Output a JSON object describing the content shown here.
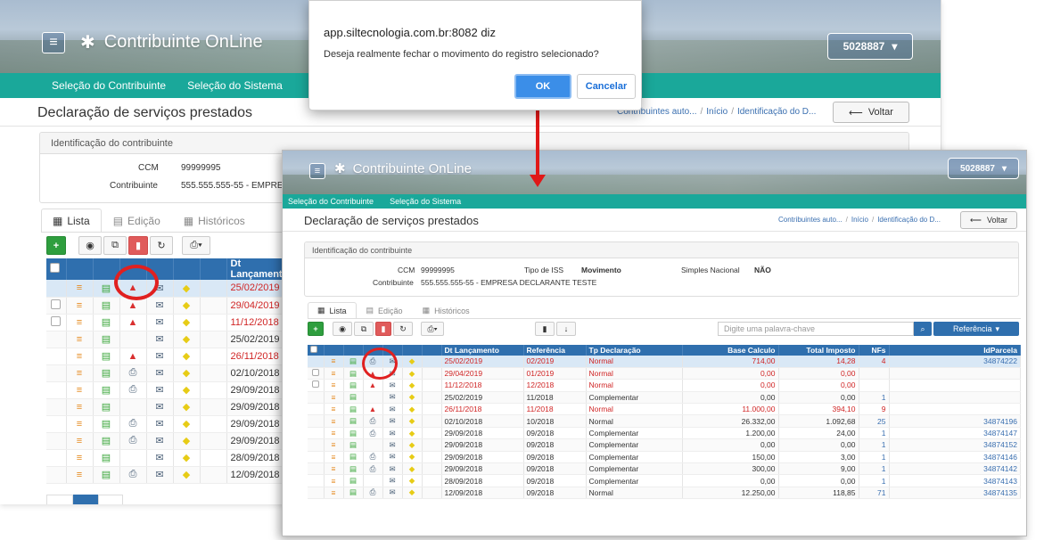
{
  "app": {
    "brand": "Contribuinte OnLine",
    "user": "5028887"
  },
  "nav": {
    "item1": "Seleção do Contribuinte",
    "item2": "Seleção do Sistema"
  },
  "page": {
    "title": "Declaração de serviços prestados",
    "breadcrumb": [
      "Contribuintes auto...",
      "Início",
      "Identificação do D..."
    ],
    "back_label": "Voltar"
  },
  "contrib": {
    "header": "Identificação do contribuinte",
    "ccm_label": "CCM",
    "ccm_value": "99999995",
    "contrib_label": "Contribuinte",
    "contrib_value": "555.555.555-55 - EMPRESA DECLARANTE TESTE",
    "contrib_value_short": "555.555.555-55 - EMPRE",
    "iss_label": "Tipo de ISS",
    "iss_value": "Movimento",
    "simples_label": "Simples Nacional",
    "simples_value": "NÃO"
  },
  "tabs": [
    "Lista",
    "Edição",
    "Históricos"
  ],
  "search": {
    "placeholder": "Digite uma palavra-chave",
    "ref_label": "Referência"
  },
  "columns": [
    "Dt Lançamento",
    "Referência",
    "Tp Declaração",
    "Base Calculo",
    "Total Imposto",
    "NFs",
    "IdParcela"
  ],
  "rows": [
    {
      "dt": "25/02/2019",
      "ref": "02/2019",
      "tp": "Normal",
      "base": "714,00",
      "imp": "14,28",
      "nfs": "4",
      "id": "34874222",
      "red": true,
      "chk": false,
      "sel": true,
      "lock": "print",
      "back_lock": "lock"
    },
    {
      "dt": "29/04/2019",
      "ref": "01/2019",
      "tp": "Normal",
      "base": "0,00",
      "imp": "0,00",
      "nfs": "",
      "id": "",
      "red": true,
      "chk": true,
      "lock": "lock"
    },
    {
      "dt": "11/12/2018",
      "ref": "12/2018",
      "tp": "Normal",
      "base": "0,00",
      "imp": "0,00",
      "nfs": "",
      "id": "",
      "red": true,
      "chk": true,
      "lock": "lock"
    },
    {
      "dt": "25/02/2019",
      "ref": "11/2018",
      "tp": "Complementar",
      "base": "0,00",
      "imp": "0,00",
      "nfs": "1",
      "id": "",
      "red": false,
      "chk": false,
      "lock": ""
    },
    {
      "dt": "26/11/2018",
      "ref": "11/2018",
      "tp": "Normal",
      "base": "11.000,00",
      "imp": "394,10",
      "nfs": "9",
      "id": "",
      "red": true,
      "chk": false,
      "lock": "lock"
    },
    {
      "dt": "02/10/2018",
      "ref": "10/2018",
      "tp": "Normal",
      "base": "26.332,00",
      "imp": "1.092,68",
      "nfs": "25",
      "id": "34874196",
      "red": false,
      "chk": false,
      "lock": "print"
    },
    {
      "dt": "29/09/2018",
      "ref": "09/2018",
      "tp": "Complementar",
      "base": "1.200,00",
      "imp": "24,00",
      "nfs": "1",
      "id": "34874147",
      "red": false,
      "chk": false,
      "lock": "print"
    },
    {
      "dt": "29/09/2018",
      "ref": "09/2018",
      "tp": "Complementar",
      "base": "0,00",
      "imp": "0,00",
      "nfs": "1",
      "id": "34874152",
      "red": false,
      "chk": false,
      "lock": ""
    },
    {
      "dt": "29/09/2018",
      "ref": "09/2018",
      "tp": "Complementar",
      "base": "150,00",
      "imp": "3,00",
      "nfs": "1",
      "id": "34874146",
      "red": false,
      "chk": false,
      "lock": "print"
    },
    {
      "dt": "29/09/2018",
      "ref": "09/2018",
      "tp": "Complementar",
      "base": "300,00",
      "imp": "9,00",
      "nfs": "1",
      "id": "34874142",
      "red": false,
      "chk": false,
      "lock": "print"
    },
    {
      "dt": "28/09/2018",
      "ref": "09/2018",
      "tp": "Complementar",
      "base": "0,00",
      "imp": "0,00",
      "nfs": "1",
      "id": "34874143",
      "red": false,
      "chk": false,
      "lock": ""
    },
    {
      "dt": "12/09/2018",
      "ref": "09/2018",
      "tp": "Normal",
      "base": "12.250,00",
      "imp": "118,85",
      "nfs": "71",
      "id": "34874135",
      "red": false,
      "chk": false,
      "lock": "print"
    }
  ],
  "dialog": {
    "title": "app.siltecnologia.com.br:8082 diz",
    "message": "Deseja realmente fechar o movimento do registro selecionado?",
    "ok": "OK",
    "cancel": "Cancelar"
  },
  "colors": {
    "teal": "#1aa89a",
    "header_blue": "#2f6fae",
    "accent_red": "#e02020"
  }
}
